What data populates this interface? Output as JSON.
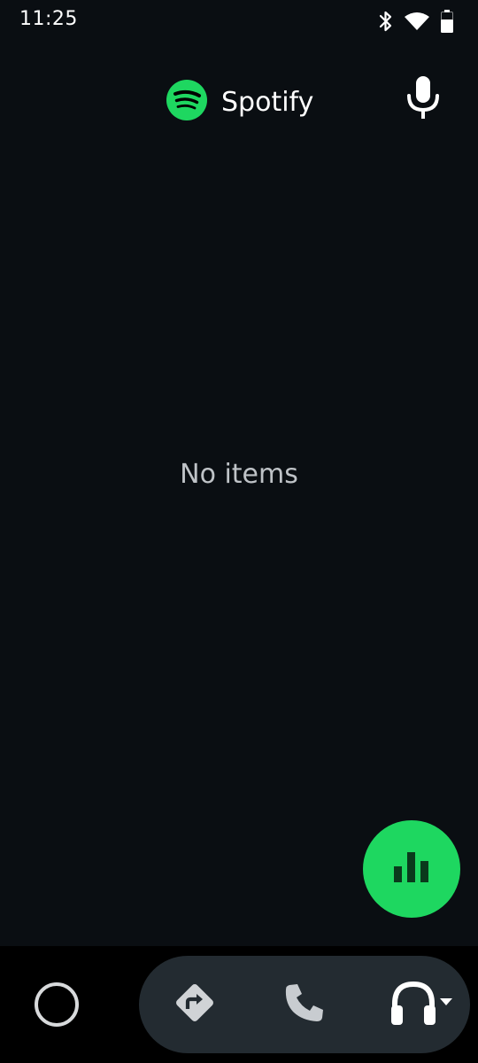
{
  "status_bar": {
    "time": "11:25",
    "icons": [
      "bluetooth-icon",
      "wifi-icon",
      "battery-icon"
    ]
  },
  "header": {
    "app_name": "Spotify",
    "logo_icon": "spotify-logo-icon",
    "action_icon": "microphone-icon"
  },
  "content": {
    "empty_text": "No items"
  },
  "fab": {
    "icon": "equalizer-bars-icon"
  },
  "bottom_nav": {
    "items": [
      {
        "icon": "home-circle-icon"
      },
      {
        "icon": "navigation-directions-icon"
      },
      {
        "icon": "phone-icon"
      },
      {
        "icon": "headphones-icon"
      }
    ]
  },
  "colors": {
    "background": "#0a0e12",
    "accent": "#1ed760",
    "nav_pill": "#232b31",
    "bottom_bar": "#000000",
    "empty_text": "#bfc3c7"
  }
}
